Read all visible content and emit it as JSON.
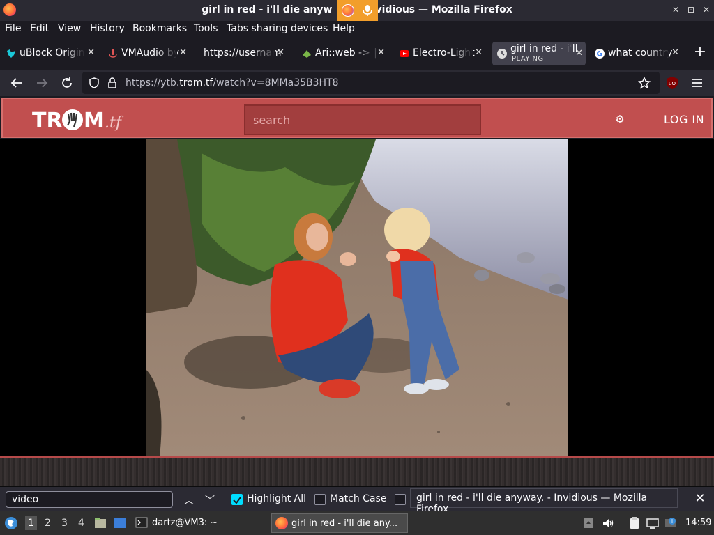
{
  "window": {
    "title": "girl in red - i'll die anyway. - Invidious — Mozilla Firefox",
    "title_left": "girl in red - i'll die anyw",
    "title_right": "vidious — Mozilla Firefox"
  },
  "menu": [
    "File",
    "Edit",
    "View",
    "History",
    "Bookmarks",
    "Tools",
    "Tabs sharing devices",
    "Help"
  ],
  "tabs": [
    {
      "label": "uBlock Origin",
      "active": false
    },
    {
      "label": "VMAudio by",
      "active": false
    },
    {
      "label": "https://usernam",
      "active": false
    },
    {
      "label": "Ari::web -> |",
      "active": false
    },
    {
      "label": "Electro-Light",
      "active": false
    },
    {
      "label": "girl in red - i'll",
      "sub": "PLAYING",
      "active": true
    },
    {
      "label": "what country",
      "active": false
    }
  ],
  "urlbar": {
    "prefix": "https://ytb.",
    "domain": "trom.tf",
    "suffix": "/watch?v=8MMa35B3HT8"
  },
  "site": {
    "logo": "TROM.tf",
    "search_placeholder": "search",
    "login": "LOG IN"
  },
  "findbar": {
    "value": "video",
    "highlight_all": "Highlight All",
    "match_case": "Match Case",
    "highlight_checked": true,
    "match_checked": false
  },
  "tooltip": "girl in red - i'll die anyway. - Invidious — Mozilla Firefox",
  "taskbar": {
    "workspaces": [
      "1",
      "2",
      "3",
      "4"
    ],
    "terminal": "dartz@VM3: ~",
    "firefox_window": "girl in red - i'll die any...",
    "clock": "14:59"
  },
  "colors": {
    "site_accent": "#c14f4f",
    "firefox_bg": "#1c1b22",
    "toolbar_bg": "#2b2a33",
    "checkbox_on": "#00ddff"
  }
}
